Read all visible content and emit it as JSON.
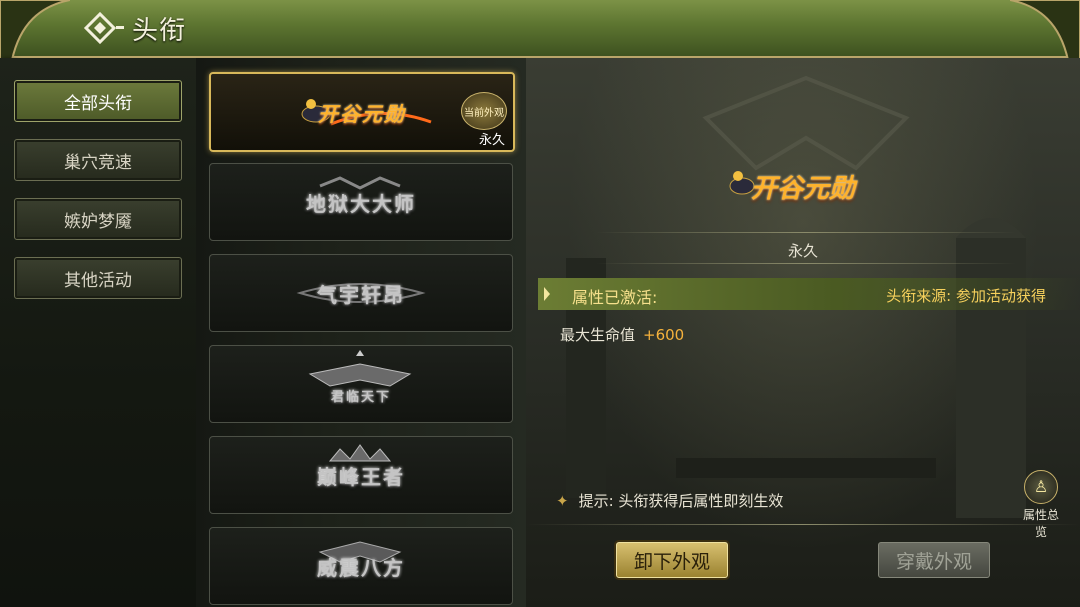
{
  "header": {
    "title": "头衔"
  },
  "sidebar": {
    "items": [
      {
        "label": "全部头衔",
        "active": true
      },
      {
        "label": "巢穴竞速",
        "active": false
      },
      {
        "label": "嫉妒梦魇",
        "active": false
      },
      {
        "label": "其他活动",
        "active": false
      }
    ]
  },
  "titles": [
    {
      "name": "开谷元勋",
      "style": "gold",
      "badge": "当前外观",
      "duration": "永久",
      "selected": true
    },
    {
      "name": "地狱大大师",
      "style": "gray",
      "selected": false
    },
    {
      "name": "气宇轩昂",
      "style": "gray",
      "selected": false
    },
    {
      "name": "君临天下",
      "style": "gray",
      "selected": false
    },
    {
      "name": "巅峰王者",
      "style": "gray",
      "selected": false
    },
    {
      "name": "威震八方",
      "style": "gray",
      "selected": false
    }
  ],
  "detail": {
    "title_name": "开谷元勋",
    "duration": "永久",
    "attr_status": "属性已激活:",
    "source": "头衔来源: 参加活动获得",
    "stat_label": "最大生命值",
    "stat_value": "+600",
    "tip": "提示: 头衔获得后属性即刻生效",
    "overview_label": "属性总览"
  },
  "buttons": {
    "unequip": "卸下外观",
    "equip": "穿戴外观"
  },
  "colors": {
    "header_green": "#5c7430",
    "gold": "#d8b85a",
    "attr_text": "#f6e08c",
    "stat_value": "#f6b23c"
  }
}
